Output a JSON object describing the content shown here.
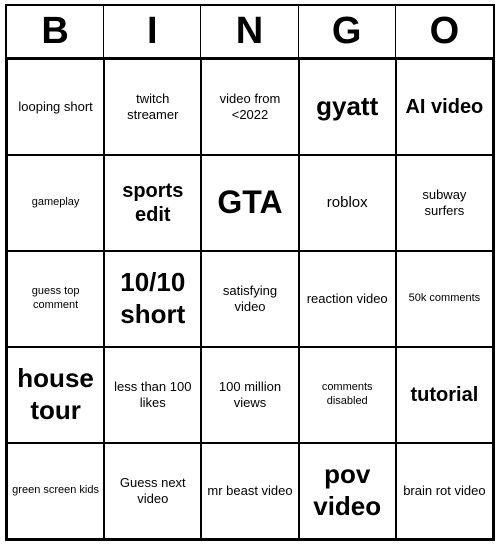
{
  "header": {
    "letters": [
      "B",
      "I",
      "N",
      "G",
      "O"
    ]
  },
  "cells": [
    {
      "text": "looping short",
      "size": "text-sm"
    },
    {
      "text": "twitch streamer",
      "size": "text-sm"
    },
    {
      "text": "video from <2022",
      "size": "text-sm"
    },
    {
      "text": "gyatt",
      "size": "text-xl"
    },
    {
      "text": "AI video",
      "size": "text-lg"
    },
    {
      "text": "gameplay",
      "size": "text-xs"
    },
    {
      "text": "sports edit",
      "size": "text-lg"
    },
    {
      "text": "GTA",
      "size": "text-xxl"
    },
    {
      "text": "roblox",
      "size": "text-md"
    },
    {
      "text": "subway surfers",
      "size": "text-sm"
    },
    {
      "text": "guess top comment",
      "size": "text-xs"
    },
    {
      "text": "10/10 short",
      "size": "text-xl"
    },
    {
      "text": "satisfying video",
      "size": "text-sm"
    },
    {
      "text": "reaction video",
      "size": "text-sm"
    },
    {
      "text": "50k comments",
      "size": "text-xs"
    },
    {
      "text": "house tour",
      "size": "text-xl"
    },
    {
      "text": "less than 100 likes",
      "size": "text-sm"
    },
    {
      "text": "100 million views",
      "size": "text-sm"
    },
    {
      "text": "comments disabled",
      "size": "text-xs"
    },
    {
      "text": "tutorial",
      "size": "text-lg"
    },
    {
      "text": "green screen kids",
      "size": "text-xs"
    },
    {
      "text": "Guess next video",
      "size": "text-sm"
    },
    {
      "text": "mr beast video",
      "size": "text-sm"
    },
    {
      "text": "pov video",
      "size": "text-xl"
    },
    {
      "text": "brain rot video",
      "size": "text-sm"
    }
  ]
}
